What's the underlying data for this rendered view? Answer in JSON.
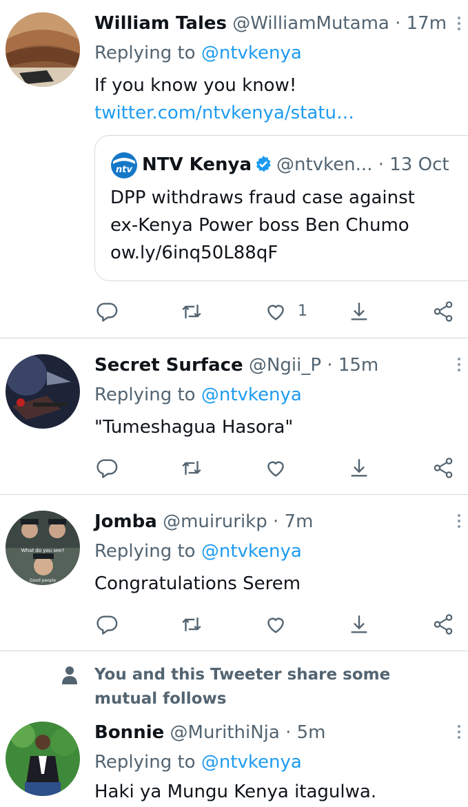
{
  "tweets": [
    {
      "name": "William Tales",
      "handle": "@WilliamMutama",
      "dot": "·",
      "time": "17m",
      "replying_prefix": "Replying to ",
      "replying_to": "@ntvkenya",
      "text": "If you know you know!",
      "link": "twitter.com/ntvkenya/statu…",
      "like_count": "1",
      "quote": {
        "name": "NTV Kenya",
        "handle": "@ntvken...",
        "time": "· 13 Oct",
        "lines": [
          "DPP withdraws fraud case against",
          "ex-Kenya Power boss Ben Chumo",
          "ow.ly/6inq50L88qF"
        ],
        "logo_text": "ntv"
      }
    },
    {
      "name": "Secret Surface",
      "handle": "@Ngii_P",
      "dot": "·",
      "time": "15m",
      "replying_prefix": "Replying to ",
      "replying_to": "@ntvkenya",
      "text": "\"Tumeshagua Hasora\""
    },
    {
      "name": "Jomba",
      "handle": "@muirurikp",
      "dot": "·",
      "time": "7m",
      "replying_prefix": "Replying to ",
      "replying_to": "@ntvkenya",
      "text": "Congratulations Serem",
      "avatar_caption_top": "What do you see?",
      "avatar_caption_bottom": "Good people"
    },
    {
      "name": "Bonnie",
      "handle": "@MurithiNja",
      "dot": "·",
      "time": "5m",
      "replying_prefix": "Replying to ",
      "replying_to": "@ntvkenya",
      "text": "Haki ya Mungu Kenya itagulwa."
    }
  ],
  "mutual_follows": "You and this Tweeter share some mutual follows",
  "icons": [
    "reply-icon",
    "retweet-icon",
    "like-icon",
    "share-down-icon",
    "share-icon",
    "more-icon",
    "verified-icon",
    "person-icon"
  ],
  "colors": {
    "accent": "#1d9bf0",
    "muted": "#536471",
    "text": "#0f1419",
    "border": "#cfd9de"
  }
}
